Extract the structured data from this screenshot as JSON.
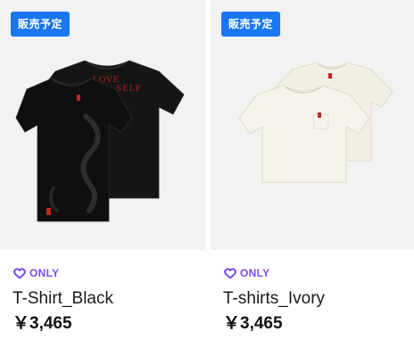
{
  "products": [
    {
      "badge": "販売予定",
      "exclusive_label": "ONLY",
      "name": "T-Shirt_Black",
      "price": "￥3,465",
      "image": {
        "shirt_color": "#1c1c1c",
        "print_text_line1": "LOVE",
        "print_text_line2": "YOURSELF",
        "tag_color": "#c8241d"
      }
    },
    {
      "badge": "販売予定",
      "exclusive_label": "ONLY",
      "name": "T-shirts_Ivory",
      "price": "￥3,465",
      "image": {
        "shirt_color": "#f4f1e8",
        "tag_color": "#c8241d"
      }
    }
  ],
  "colors": {
    "badge_bg": "#1977f2",
    "only_accent": "#7b4cf0",
    "thumb_bg": "#f2f2f2"
  }
}
